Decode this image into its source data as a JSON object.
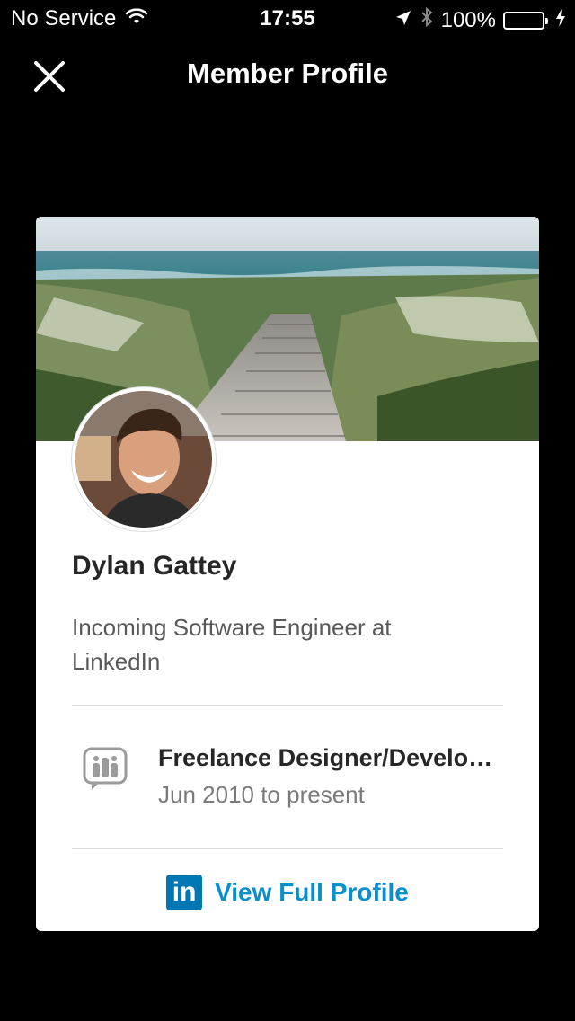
{
  "status_bar": {
    "carrier": "No Service",
    "time": "17:55",
    "battery": "100%",
    "battery_level": 1.0,
    "icons": [
      "wifi-icon",
      "location-arrow-icon",
      "bluetooth-icon",
      "battery-icon",
      "charging-icon"
    ]
  },
  "nav": {
    "title": "Member Profile",
    "close_icon": "close-icon"
  },
  "profile": {
    "name": "Dylan Gattey",
    "headline": "Incoming Software Engineer at LinkedIn",
    "position": {
      "title": "Freelance Designer/Develo…",
      "dates": "Jun 2010 to present",
      "icon": "company-placeholder-icon"
    },
    "view_full_profile": {
      "logo_text": "in",
      "label": "View Full Profile"
    }
  },
  "colors": {
    "background": "#000000",
    "card": "#ffffff",
    "link": "#0a8fce",
    "linkedin_brand": "#0077b5",
    "battery": "#4cd964"
  }
}
